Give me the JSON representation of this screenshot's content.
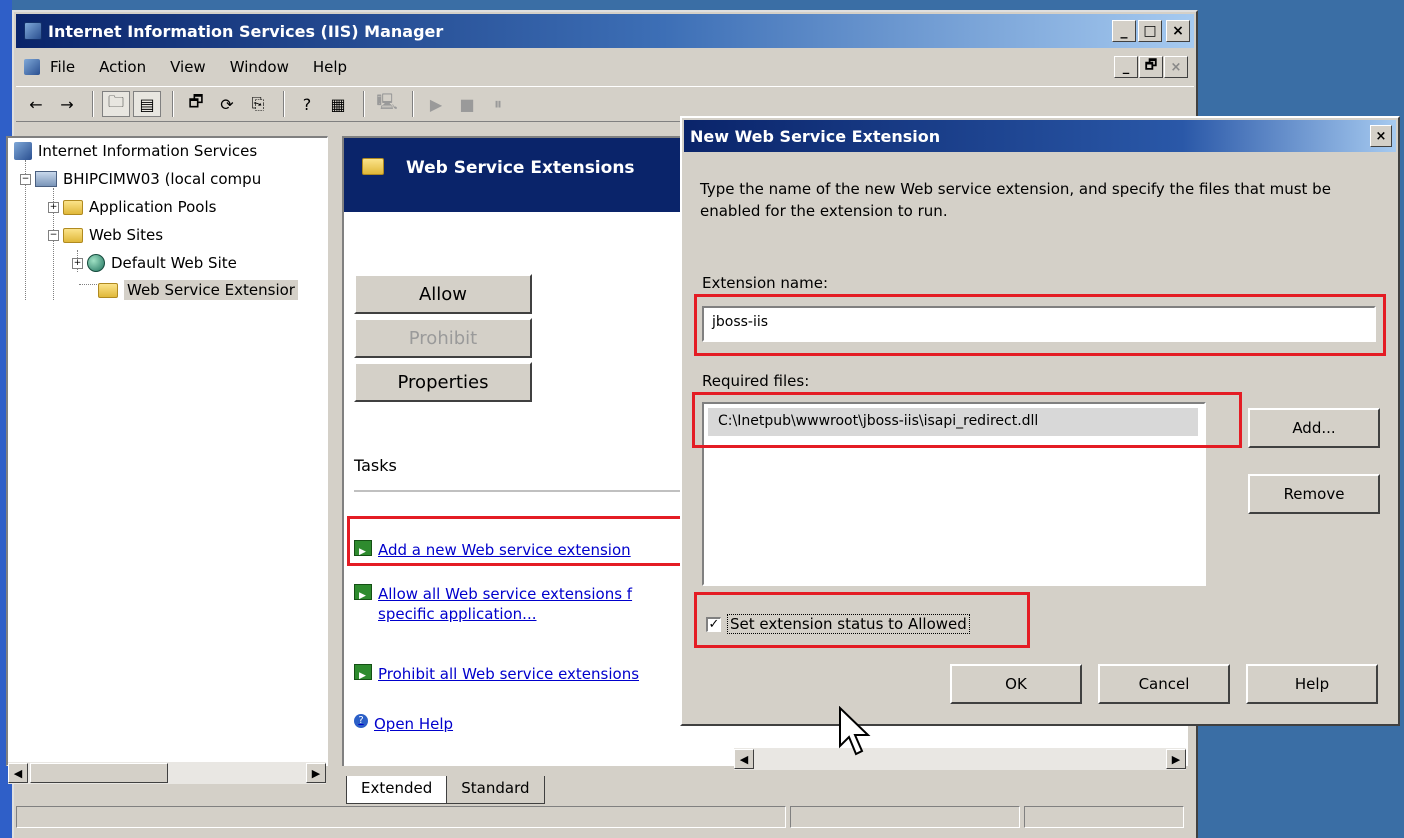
{
  "window": {
    "title": "Internet Information Services (IIS) Manager",
    "controls": {
      "minimize": "_",
      "maximize": "□",
      "close": "×"
    }
  },
  "menu": {
    "items": [
      "File",
      "Action",
      "View",
      "Window",
      "Help"
    ],
    "mdi_controls": {
      "minimize": "_",
      "restore": "🗗",
      "close": "×"
    }
  },
  "toolbar": {
    "back": "←",
    "forward": "→",
    "up": "🗀",
    "show_tree": "▤",
    "properties": "🗗",
    "refresh": "⟳",
    "export": "⎘",
    "help": "?",
    "console": "▦",
    "computer": "🖳",
    "play": "▶",
    "stop": "■",
    "pause": "⏸"
  },
  "tree": {
    "root": "Internet Information Services",
    "server": "BHIPCIMW03 (local compu",
    "app_pools": "Application Pools",
    "web_sites": "Web Sites",
    "default_site": "Default Web Site",
    "web_service_ext": "Web Service Extensior"
  },
  "right_pane": {
    "header": "Web Service Extensions",
    "buttons": {
      "allow": "Allow",
      "prohibit": "Prohibit",
      "properties": "Properties"
    },
    "tasks_label": "Tasks",
    "tasks": {
      "add": "Add a new Web service extension",
      "allow_all": "Allow all Web service extensions f",
      "allow_all_line2": "specific application...",
      "prohibit_all": "Prohibit all Web service extensions",
      "help": "Open Help"
    }
  },
  "tabs": {
    "extended": "Extended",
    "standard": "Standard"
  },
  "dialog": {
    "title": "New Web Service Extension",
    "close": "×",
    "description": "Type the name of the new Web service extension, and specify the files that must be enabled for the extension to run.",
    "extension_name_label": "Extension name:",
    "extension_name_value": "jboss-iis",
    "required_files_label": "Required files:",
    "required_files": [
      "C:\\Inetpub\\wwwroot\\jboss-iis\\isapi_redirect.dll"
    ],
    "add_button": "Add...",
    "remove_button": "Remove",
    "checkbox_label": "Set extension status to Allowed",
    "checkbox_checked": true,
    "checkbox_mark": "✓",
    "ok": "OK",
    "cancel": "Cancel",
    "help": "Help"
  },
  "scroll_arrows": {
    "left": "◀",
    "right": "▶"
  },
  "tree_toggles": {
    "plus": "+",
    "minus": "−"
  },
  "icons": {
    "help_glyph": "?",
    "cursor": "pointer-arrow-icon"
  },
  "colors": {
    "highlight_box": "#e41c24",
    "title_bar": "#0a246a",
    "desktop": "#3a6ea5",
    "link": "#0000cc"
  }
}
